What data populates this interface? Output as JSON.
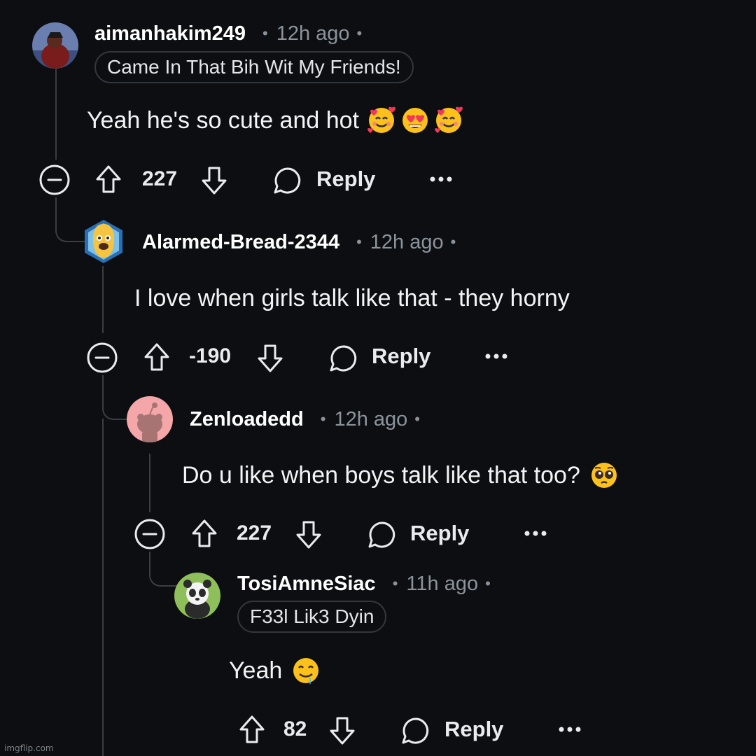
{
  "comments": [
    {
      "username": "aimanhakim249",
      "separator": "•",
      "time": "12h ago",
      "flair": "Came In That Bih Wit My Friends!",
      "body": "Yeah he's so cute and hot",
      "emojis": [
        "smiling-face-with-hearts",
        "heart-eyes",
        "smiling-face-with-hearts"
      ],
      "score": "227",
      "reply_label": "Reply",
      "avatar_color": "#6a7fb0"
    },
    {
      "username": "Alarmed-Bread-2344",
      "separator": "•",
      "time": "12h ago",
      "body": "I love when girls talk like that - they horny",
      "score": "-190",
      "reply_label": "Reply",
      "avatar_color": "#f5c542"
    },
    {
      "username": "Zenloadedd",
      "separator": "•",
      "time": "12h ago",
      "body": "Do u like when boys talk like that too?",
      "emojis": [
        "pleading-face"
      ],
      "score": "227",
      "reply_label": "Reply",
      "avatar_color": "#f4a6a8"
    },
    {
      "username": "TosiAmneSiac",
      "separator": "•",
      "time": "11h ago",
      "flair": "F33l Lik3 Dyin",
      "body": "Yeah",
      "emojis": [
        "drooling-face"
      ],
      "score": "82",
      "reply_label": "Reply",
      "avatar_color": "#8fbf5a"
    }
  ],
  "icons": {
    "collapse": "collapse-icon",
    "upvote": "upvote-icon",
    "downvote": "downvote-icon",
    "reply": "reply-bubble-icon",
    "more": "more-options-icon"
  },
  "colors": {
    "background": "#0c0e11",
    "text": "#ffffff",
    "muted": "#8b939c",
    "thread_line": "#3a3d42"
  },
  "watermark": "imgflip.com"
}
